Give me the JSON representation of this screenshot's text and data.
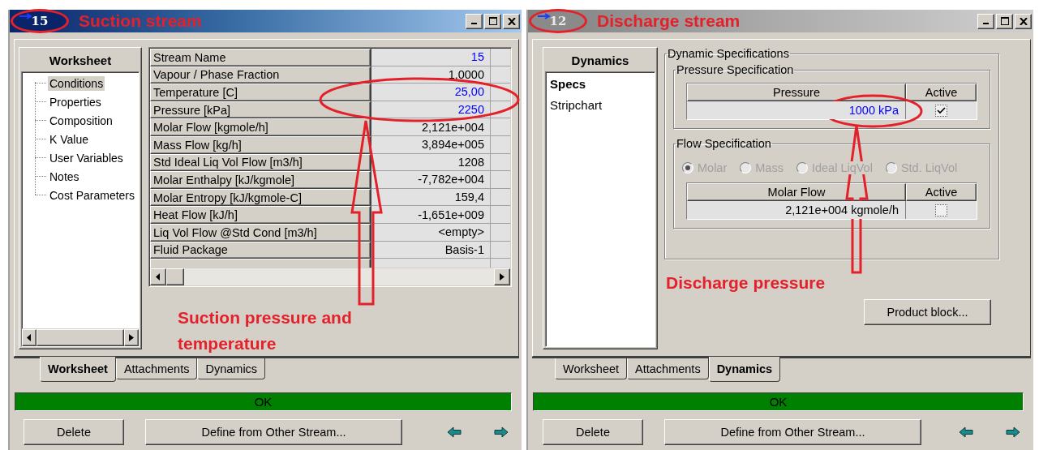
{
  "windows": [
    {
      "kind": "worksheet",
      "active": true,
      "stream_number": "15",
      "title_note": "Suction stream",
      "nav": {
        "header": "Worksheet",
        "items": [
          {
            "label": "Conditions",
            "selected": true
          },
          {
            "label": "Properties",
            "selected": false
          },
          {
            "label": "Composition",
            "selected": false
          },
          {
            "label": "K Value",
            "selected": false
          },
          {
            "label": "User Variables",
            "selected": false
          },
          {
            "label": "Notes",
            "selected": false
          },
          {
            "label": "Cost Parameters",
            "selected": false
          }
        ]
      },
      "table": {
        "rows": [
          {
            "label": "Stream Name",
            "value": "15",
            "specified": true
          },
          {
            "label": "Vapour / Phase Fraction",
            "value": "1,0000",
            "specified": false
          },
          {
            "label": "Temperature [C]",
            "value": "25,00",
            "specified": true
          },
          {
            "label": "Pressure [kPa]",
            "value": "2250",
            "specified": true
          },
          {
            "label": "Molar Flow [kgmole/h]",
            "value": "2,121e+004",
            "specified": false
          },
          {
            "label": "Mass Flow [kg/h]",
            "value": "3,894e+005",
            "specified": false
          },
          {
            "label": "Std Ideal Liq Vol Flow [m3/h]",
            "value": "1208",
            "specified": false
          },
          {
            "label": "Molar Enthalpy [kJ/kgmole]",
            "value": "-7,782e+004",
            "specified": false
          },
          {
            "label": "Molar Entropy [kJ/kgmole-C]",
            "value": "159,4",
            "specified": false
          },
          {
            "label": "Heat Flow [kJ/h]",
            "value": "-1,651e+009",
            "specified": false
          },
          {
            "label": "Liq Vol Flow @Std Cond [m3/h]",
            "value": "<empty>",
            "specified": false
          },
          {
            "label": "Fluid Package",
            "value": "Basis-1",
            "specified": false
          }
        ]
      },
      "note": "Suction pressure and temperature",
      "tabs": [
        {
          "label": "Worksheet",
          "selected": true
        },
        {
          "label": "Attachments",
          "selected": false
        },
        {
          "label": "Dynamics",
          "selected": false
        }
      ],
      "status": "OK",
      "buttons": [
        "Delete",
        "Define from Other Stream..."
      ]
    },
    {
      "kind": "dynamics",
      "active": false,
      "stream_number": "12",
      "title_note": "Discharge stream",
      "nav": {
        "header": "Dynamics",
        "items": [
          {
            "label": "Specs",
            "selected": true
          },
          {
            "label": "Stripchart",
            "selected": false
          }
        ]
      },
      "dynamic_specs": {
        "title": "Dynamic Specifications",
        "pressure_spec": {
          "title": "Pressure Specification",
          "columns": [
            "Pressure",
            "Active"
          ],
          "value": "1000 kPa",
          "active": true
        },
        "flow_spec": {
          "title": "Flow Specification",
          "disabled": true,
          "options": [
            {
              "label": "Molar",
              "selected": true
            },
            {
              "label": "Mass",
              "selected": false
            },
            {
              "label": "Ideal LiqVol",
              "selected": false
            },
            {
              "label": "Std. LiqVol",
              "selected": false
            }
          ],
          "columns": [
            "Molar Flow",
            "Active"
          ],
          "value": "2,121e+004 kgmole/h",
          "active": false
        }
      },
      "note": "Discharge pressure",
      "product_button": "Product block...",
      "tabs": [
        {
          "label": "Worksheet",
          "selected": false
        },
        {
          "label": "Attachments",
          "selected": false
        },
        {
          "label": "Dynamics",
          "selected": true
        }
      ],
      "status": "OK",
      "buttons": [
        "Delete",
        "Define from Other Stream..."
      ]
    }
  ]
}
